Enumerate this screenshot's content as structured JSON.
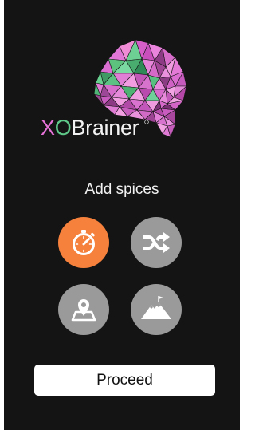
{
  "logo": {
    "text_x": "X",
    "text_o": "O",
    "text_rest": "Brainer"
  },
  "subtitle": "Add spices",
  "spices": [
    {
      "icon": "stopwatch-icon",
      "selected": true
    },
    {
      "icon": "shuffle-icon",
      "selected": false
    },
    {
      "icon": "map-pin-icon",
      "selected": false
    },
    {
      "icon": "mountain-flag-icon",
      "selected": false
    }
  ],
  "proceed_label": "Proceed",
  "colors": {
    "background": "#141414",
    "accent": "#f5813d",
    "inactive": "#9a9a9a",
    "logo_x": "#e573d8",
    "logo_o": "#5fc98a"
  }
}
